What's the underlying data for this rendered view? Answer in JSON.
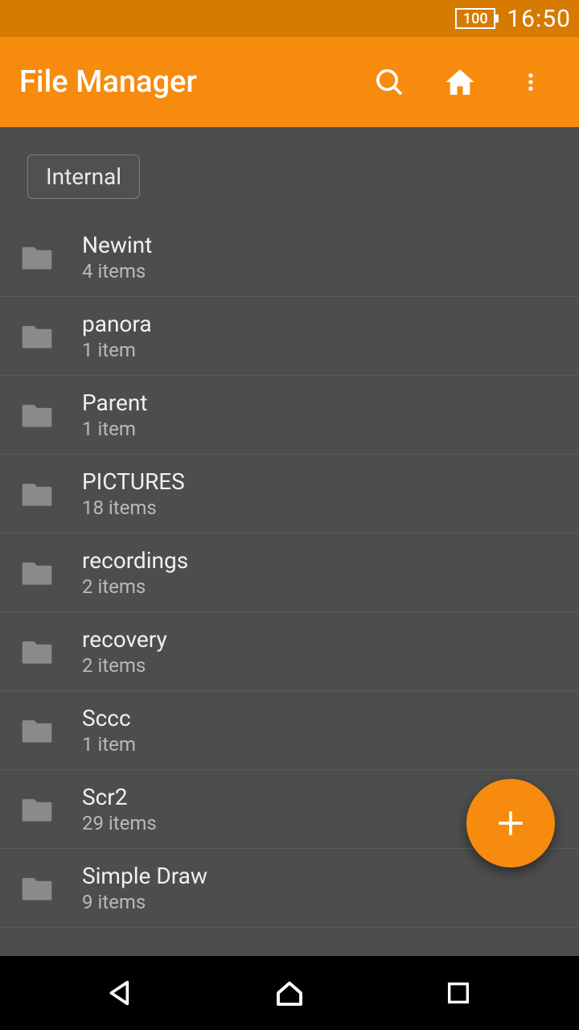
{
  "status": {
    "battery": "100",
    "time": "16:50"
  },
  "header": {
    "title": "File Manager"
  },
  "breadcrumb": {
    "label": "Internal"
  },
  "folders": [
    {
      "name": "Newint",
      "sub": "4 items"
    },
    {
      "name": "panora",
      "sub": "1 item"
    },
    {
      "name": "Parent",
      "sub": "1 item"
    },
    {
      "name": "PICTURES",
      "sub": "18 items"
    },
    {
      "name": "recordings",
      "sub": "2 items"
    },
    {
      "name": "recovery",
      "sub": "2 items"
    },
    {
      "name": "Sccc",
      "sub": "1 item"
    },
    {
      "name": "Scr2",
      "sub": "29 items"
    },
    {
      "name": "Simple Draw",
      "sub": "9 items"
    }
  ]
}
